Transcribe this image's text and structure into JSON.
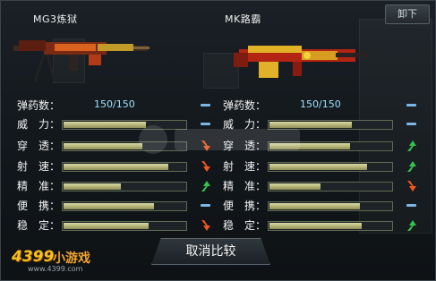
{
  "header": {
    "close_label": "卸下"
  },
  "left_gun": {
    "name": "MG3炼狱",
    "stats": [
      {
        "label": "弹药数：",
        "value_text": "150/150",
        "fill": null,
        "indicator": "dash"
      },
      {
        "label": "威　力：",
        "fill": 0.68,
        "indicator": "dash"
      },
      {
        "label": "穿　透：",
        "fill": 0.65,
        "indicator": "down-arrow"
      },
      {
        "label": "射　速：",
        "fill": 0.86,
        "indicator": "down-arrow"
      },
      {
        "label": "精　准：",
        "fill": 0.47,
        "indicator": "up-arrow"
      },
      {
        "label": "便　携：",
        "fill": 0.74,
        "indicator": "dash"
      },
      {
        "label": "稳　定：",
        "fill": 0.7,
        "indicator": "down-arrow"
      }
    ]
  },
  "right_gun": {
    "name": "MK路霸",
    "stats": [
      {
        "label": "弹药数：",
        "value_text": "150/150",
        "fill": null,
        "indicator": "dash"
      },
      {
        "label": "威　力：",
        "fill": 0.68,
        "indicator": "dash"
      },
      {
        "label": "穿　透：",
        "fill": 0.66,
        "indicator": "up-arrow"
      },
      {
        "label": "射　速：",
        "fill": 0.8,
        "indicator": "up-arrow"
      },
      {
        "label": "精　准：",
        "fill": 0.42,
        "indicator": "down-arrow"
      },
      {
        "label": "便　携：",
        "fill": 0.74,
        "indicator": "dash"
      },
      {
        "label": "稳　定：",
        "fill": 0.76,
        "indicator": "up-arrow"
      }
    ]
  },
  "footer": {
    "cancel_label": "取消比较"
  },
  "watermark": {
    "logo_text": "4399",
    "logo_suffix": "小游戏",
    "site": "www.4399.com"
  },
  "colors": {
    "up": "#37c24a",
    "down": "#f2551f",
    "dash": "#7bb7e6",
    "bar": "#c9c890"
  }
}
